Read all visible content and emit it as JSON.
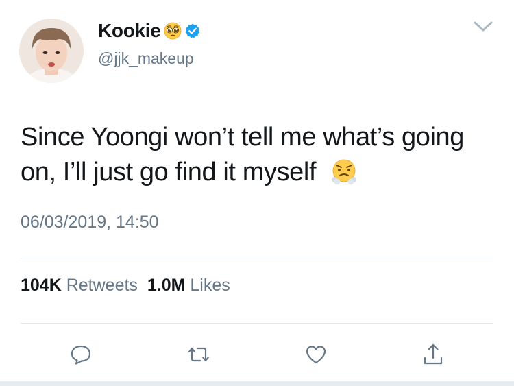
{
  "user": {
    "display_name": "Kookie",
    "handle": "@jjk_makeup"
  },
  "icons": {
    "name_emoji": "pleading-face-emoji",
    "verified": "verified-badge-icon",
    "text_emoji": "face-with-steam-emoji"
  },
  "tweet": {
    "text": "Since Yoongi won’t tell me what’s going on, I’ll just go find it myself",
    "timestamp": "06/03/2019, 14:50"
  },
  "stats": {
    "retweets_count": "104K",
    "retweets_label": "Retweets",
    "likes_count": "1.0M",
    "likes_label": "Likes"
  },
  "actions": [
    "reply-icon",
    "retweet-icon",
    "like-icon",
    "share-icon"
  ],
  "colors": {
    "text": "#14171a",
    "secondary": "#657786",
    "verified": "#1da1f2",
    "divider": "#e1e8ed"
  }
}
